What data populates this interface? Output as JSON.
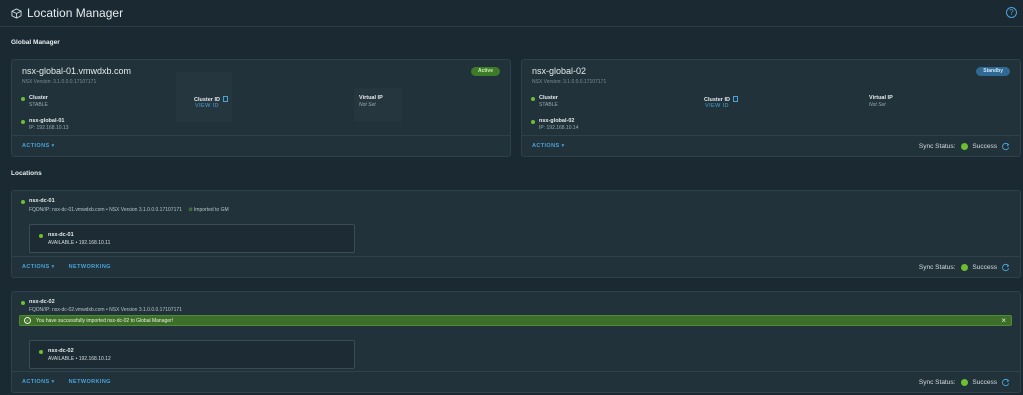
{
  "header": {
    "title": "Location Manager",
    "help_icon": "help-icon",
    "app_icon": "cube-icon"
  },
  "global_manager": {
    "section_title": "Global Manager",
    "cards": [
      {
        "name": "nsx-global-01.vmwdxb.com",
        "version": "NSX Version: 3.1.0.0.0.17107171",
        "status_badge": "Active",
        "cluster_label": "Cluster",
        "cluster_value": "STABLE",
        "cluster_id_label": "Cluster ID",
        "cluster_id_link": "VIEW ID",
        "vip_label": "Virtual IP",
        "vip_value": "Not Set",
        "node_name": "nsx-global-01",
        "node_ip": "IP: 192.168.10.13",
        "actions": "ACTIONS"
      },
      {
        "name": "nsx-global-02",
        "version": "NSX Version: 3.1.0.0.0.17107171",
        "status_badge": "Standby",
        "cluster_label": "Cluster",
        "cluster_value": "STABLE",
        "cluster_id_label": "Cluster ID",
        "cluster_id_link": "VIEW ID",
        "vip_label": "Virtual IP",
        "vip_value": "Not Set",
        "node_name": "nsx-global-02",
        "node_ip": "IP: 192.168.10.14",
        "actions": "ACTIONS",
        "sync_label": "Sync Status:",
        "sync_value": "Success"
      }
    ]
  },
  "locations": {
    "section_title": "Locations",
    "items": [
      {
        "name": "nsx-dc-01",
        "fqdn": "FQDN/IP: nsx-dc-01.vmwdxb.com • NSX Version 3.1.0.0.0.17107171",
        "imported": "Imported to GM",
        "node_name": "nsx-dc-01",
        "node_status": "AVAILABLE • 192.168.10.11",
        "actions": "ACTIONS",
        "networking": "NETWORKING",
        "sync_label": "Sync Status:",
        "sync_value": "Success"
      },
      {
        "name": "nsx-dc-02",
        "fqdn": "FQDN/IP: nsx-dc-02.vmwdxb.com • NSX Version 3.1.0.0.0.17107171",
        "success_message": "You have successfully imported nsx-dc-02 to Global Manager!",
        "node_name": "nsx-dc-02",
        "node_status": "AVAILABLE • 192.168.10.12",
        "actions": "ACTIONS",
        "networking": "NETWORKING",
        "sync_label": "Sync Status:",
        "sync_value": "Success"
      }
    ]
  },
  "colors": {
    "background": "#1b2a32",
    "card": "#22323b",
    "accent": "#49a3d9",
    "success": "#6cbf2f",
    "active_badge": "#3d7a2a",
    "standby_badge": "#2e6a93"
  }
}
